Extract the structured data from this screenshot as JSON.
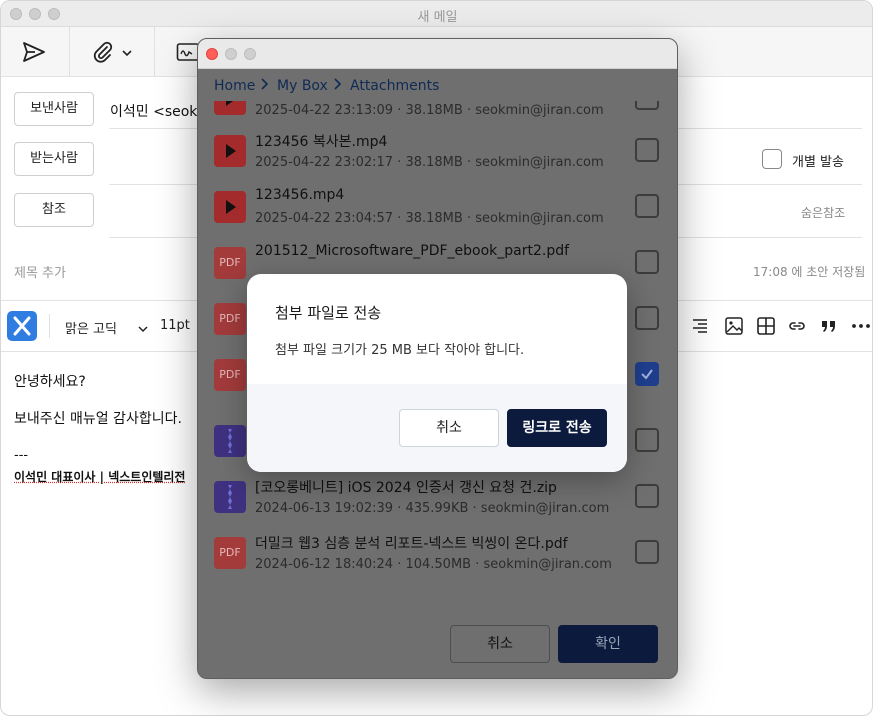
{
  "main": {
    "title": "새 메일",
    "fields": {
      "sender_button": "보낸사람",
      "sender_value": "이석민 <seokm",
      "to_button": "받는사람",
      "cc_button": "참조",
      "individual_send": "개별 발송",
      "bcc": "숨은참조",
      "subject_placeholder": "제목 추가",
      "autosave": "17:08 에 초안 저장됨"
    },
    "editor": {
      "font": "맑은 고딕",
      "size": "11pt"
    },
    "body": {
      "line1": "안녕하세요?",
      "line2": "보내주신 매뉴얼 감사합니다.",
      "line3": "---",
      "signature": "이석민 대표이사  |  넥스트인텔리전"
    }
  },
  "browser": {
    "breadcrumb": [
      "Home",
      "My Box",
      "Attachments"
    ],
    "files": [
      {
        "name": "",
        "meta": "2025-04-22 23:13:09 · 38.18MB · seokmin@jiran.com",
        "type": "video",
        "checked": false
      },
      {
        "name": "123456 복사본.mp4",
        "meta": "2025-04-22 23:02:17 · 38.18MB · seokmin@jiran.com",
        "type": "video",
        "checked": false
      },
      {
        "name": "123456.mp4",
        "meta": "2025-04-22 23:04:57 · 38.18MB · seokmin@jiran.com",
        "type": "video",
        "checked": false
      },
      {
        "name": "201512_Microsoftware_PDF_ebook_part2.pdf",
        "meta": "",
        "type": "pdf",
        "checked": false
      },
      {
        "name": "",
        "meta": "",
        "type": "pdf",
        "checked": false
      },
      {
        "name": "",
        "meta": "",
        "type": "pdf",
        "checked": true
      },
      {
        "name": "",
        "meta": "",
        "type": "zip",
        "checked": false
      },
      {
        "name": "[코오롱베니트] iOS 2024 인증서 갱신 요청 건.zip",
        "meta": "2024-06-13 19:02:39 · 435.99KB · seokmin@jiran.com",
        "type": "zip",
        "checked": false
      },
      {
        "name": "더밀크 웹3 심층 분석 리포트-넥스트 빅씽이 온다.pdf",
        "meta": "2024-06-12 18:40:24 · 104.50MB · seokmin@jiran.com",
        "type": "pdf",
        "checked": false
      }
    ],
    "pdf_label": "PDF",
    "cancel": "취소",
    "confirm": "확인"
  },
  "alert": {
    "title": "첨부 파일로 전송",
    "message": "첨부 파일 크기가 25 MB 보다 작아야 합니다.",
    "cancel": "취소",
    "link_send": "링크로 전송"
  }
}
